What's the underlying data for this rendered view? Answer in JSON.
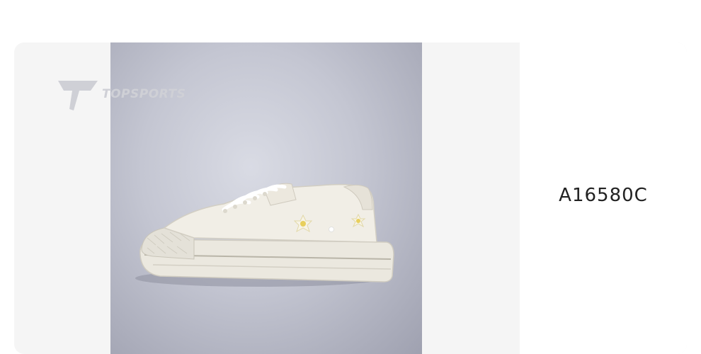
{
  "brand": {
    "name": "TOPSPORTS",
    "logo_color": "#cfd0d6"
  },
  "product": {
    "image_icon": "sneaker-image",
    "sku": "A16580C"
  },
  "colors": {
    "card_bg": "#f5f5f5",
    "panel_bg": "#ffffff",
    "text": "#222222"
  }
}
